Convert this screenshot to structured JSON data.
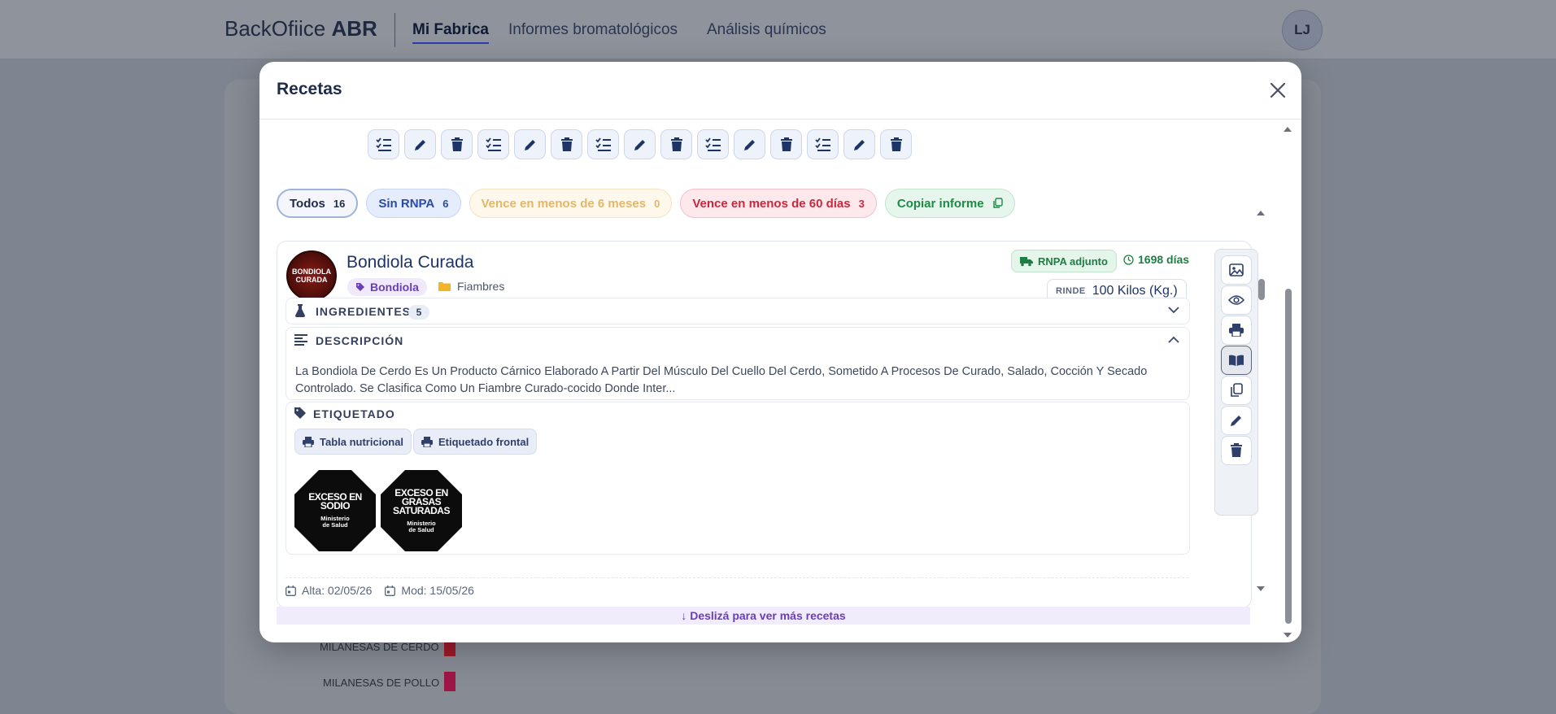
{
  "background": {
    "brand_light": "BackOfiice ",
    "brand_bold": "ABR",
    "nav": [
      {
        "label": "Mi Fabrica",
        "active": true
      },
      {
        "label": "Informes bromatológicos",
        "active": false
      },
      {
        "label": "Análisis químicos",
        "active": false
      }
    ],
    "avatar_initials": "LJ",
    "chart_labels": [
      "MILANESAS DE CERDO",
      "MILANESAS DE POLLO"
    ]
  },
  "modal": {
    "title": "Recetas",
    "close_icon": "close-icon"
  },
  "toolbar_icons": [
    "checklist-icon",
    "pencil-icon",
    "trash-icon",
    "checklist-icon",
    "pencil-icon",
    "trash-icon",
    "checklist-icon",
    "pencil-icon",
    "trash-icon",
    "checklist-icon",
    "pencil-icon",
    "trash-icon",
    "checklist-icon",
    "pencil-icon",
    "trash-icon"
  ],
  "filters": {
    "all": {
      "label": "Todos",
      "count": "16"
    },
    "sin_rnpa": {
      "label": "Sin RNPA",
      "count": "6"
    },
    "vence_6m": {
      "label": "Vence en menos de 6 meses",
      "count": "0"
    },
    "vence_60d": {
      "label": "Vence en menos de 60 días",
      "count": "3"
    },
    "copy": {
      "label": "Copiar informe"
    }
  },
  "recipe": {
    "logo_text_1": "BONDIOLA",
    "logo_text_2": "CURADA",
    "name": "Bondiola Curada",
    "tag": "Bondiola",
    "category": "Fiambres",
    "rnpa_badge": "RNPA adjunto",
    "days": "1698 días",
    "rinde_label": "RINDE",
    "rinde_value": "100 Kilos (Kg.)",
    "ingredients_title": "INGREDIENTES",
    "ingredients_count": "5",
    "description_title": "DESCRIPCIÓN",
    "description": "La Bondiola De Cerdo Es Un Producto Cárnico Elaborado A Partir Del Músculo Del Cuello Del Cerdo, Sometido A Procesos De Curado, Salado, Cocción Y Secado Controlado. Se Clasifica Como Un Fiambre Curado-cocido Donde Inter...",
    "labeling_title": "ETIQUETADO",
    "btn_nutrition": "Tabla nutricional",
    "btn_front": "Etiquetado frontal",
    "seals": [
      {
        "lines": [
          "EXCESO EN",
          "SODIO"
        ],
        "ministry": [
          "Ministerio",
          "de Salud"
        ]
      },
      {
        "lines": [
          "EXCESO EN",
          "GRASAS",
          "SATURADAS"
        ],
        "ministry": [
          "Ministerio",
          "de Salud"
        ]
      }
    ],
    "alta": "Alta: 02/05/26",
    "mod": "Mod: 15/05/26"
  },
  "actions": [
    "image-icon",
    "eye-icon",
    "printer-icon",
    "book-icon",
    "copy-icon",
    "pencil-icon",
    "trash-icon"
  ],
  "scroll_hint": "↓ Deslizá para ver más recetas",
  "colors": {
    "accent": "#2b4aa6",
    "danger": "#c9283d",
    "success": "#1f7e43",
    "purple": "#6a3fb5"
  }
}
